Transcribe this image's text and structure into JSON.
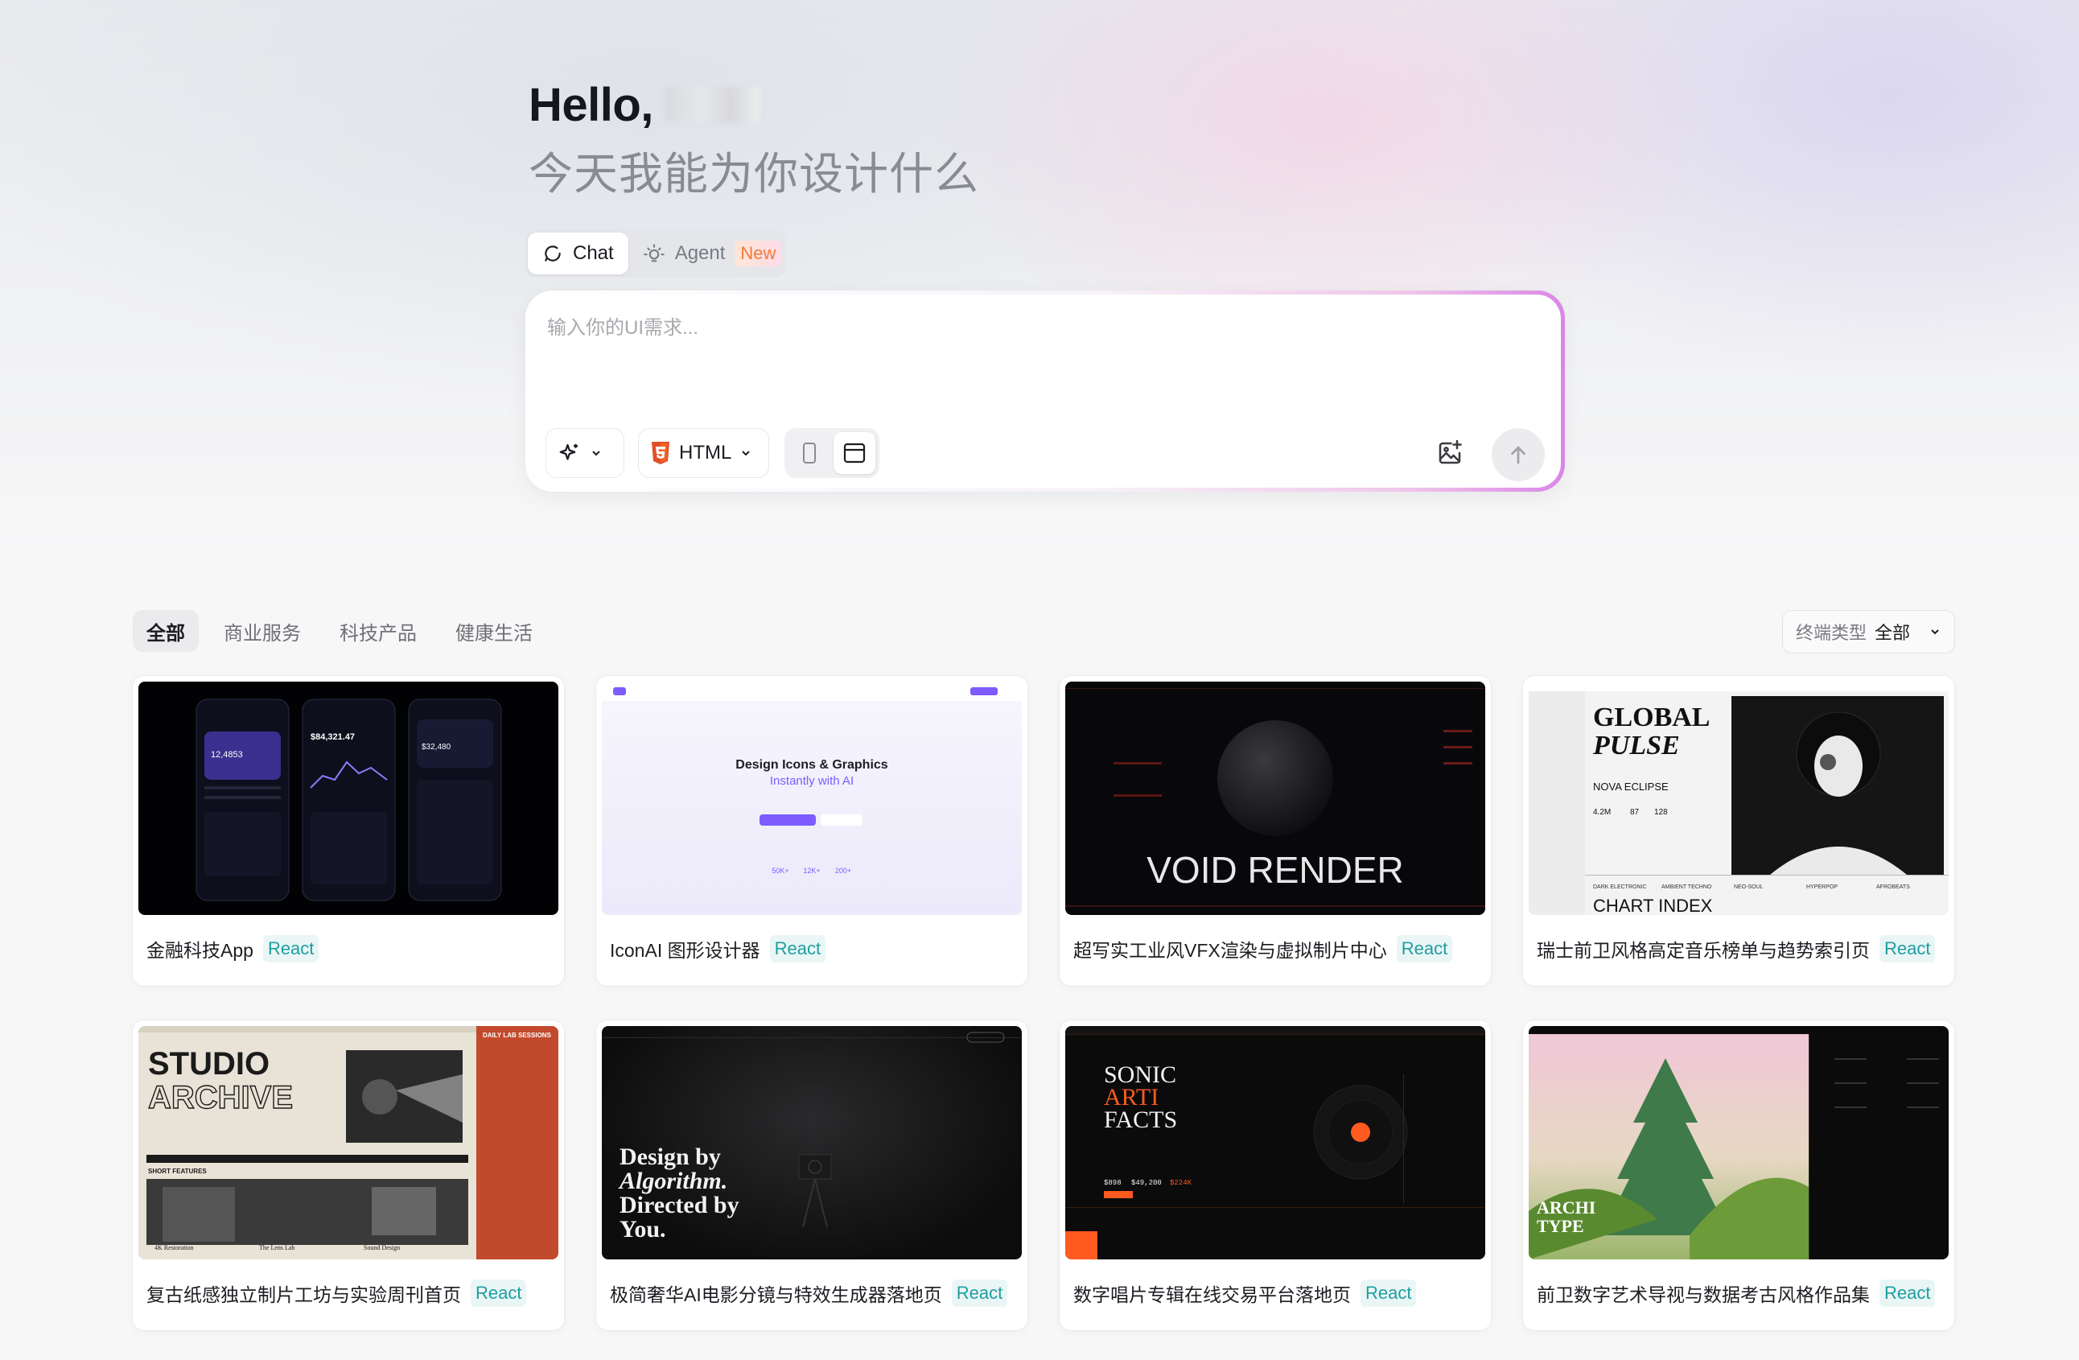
{
  "greeting": {
    "hello": "Hello,",
    "subtitle": "今天我能为你设计什么"
  },
  "modes": [
    {
      "label": "Chat",
      "icon": "chat-icon",
      "active": true
    },
    {
      "label": "Agent",
      "icon": "bulb-icon",
      "badge": "New",
      "active": false
    }
  ],
  "prompt": {
    "placeholder": "输入你的UI需求...",
    "framework_label": "HTML",
    "framework_icon": "html5-icon",
    "devices": [
      "mobile",
      "desktop"
    ],
    "active_device": "desktop"
  },
  "categories": [
    {
      "label": "全部",
      "active": true
    },
    {
      "label": "商业服务"
    },
    {
      "label": "科技产品"
    },
    {
      "label": "健康生活"
    }
  ],
  "filter": {
    "label": "终端类型",
    "value": "全部"
  },
  "cards": [
    {
      "title": "金融科技App",
      "tag": "React",
      "thumb": {
        "kind": "fintech",
        "texts": [
          "$84,321.47",
          "12,4853",
          "$32,480"
        ]
      }
    },
    {
      "title": "IconAI 图形设计器",
      "tag": "React",
      "thumb": {
        "kind": "iconai",
        "texts": [
          "Design Icons & Graphics",
          "Instantly with AI",
          "50K+",
          "12K+",
          "200+"
        ]
      }
    },
    {
      "title": "超写实工业风VFX渲染与虚拟制片中心",
      "tag": "React",
      "thumb": {
        "kind": "void",
        "texts": [
          "VOID RENDER"
        ]
      }
    },
    {
      "title": "瑞士前卫风格高定音乐榜单与趋势索引页",
      "tag": "React",
      "thumb": {
        "kind": "pulse",
        "texts": [
          "GLOBAL",
          "PULSE",
          "NOVA ECLIPSE",
          "4.2M",
          "87",
          "128",
          "CHART INDEX",
          "DARK ELECTRONIC",
          "AMBIENT TECHNO",
          "NEO-SOUL",
          "HYPERPOP",
          "AFROBEATS"
        ]
      }
    },
    {
      "title": "复古纸感独立制片工坊与实验周刊首页",
      "tag": "React",
      "thumb": {
        "kind": "studio",
        "texts": [
          "STUDIO",
          "ARCHIVE",
          "DAILY LAB SESSIONS",
          "SHORT FEATURES",
          "4K Restoration",
          "The Lens Lab",
          "Sound Design"
        ]
      }
    },
    {
      "title": "极简奢华AI电影分镜与特效生成器落地页",
      "tag": "React",
      "thumb": {
        "kind": "design",
        "texts": [
          "Design by",
          "Algorithm.",
          "Directed by",
          "You."
        ]
      }
    },
    {
      "title": "数字唱片专辑在线交易平台落地页",
      "tag": "React",
      "thumb": {
        "kind": "sonic",
        "texts": [
          "SONIC",
          "ARTI",
          "FACTS",
          "$898",
          "$49,200",
          "$224K"
        ]
      }
    },
    {
      "title": "前卫数字艺术导视与数据考古风格作品集",
      "tag": "React",
      "thumb": {
        "kind": "archi",
        "texts": [
          "ARCHI",
          "TYPE"
        ]
      }
    }
  ],
  "colors": {
    "accent_react": "#1f9ea0",
    "new_badge": "#f07a3a",
    "glow_pink": "#d987e5"
  }
}
